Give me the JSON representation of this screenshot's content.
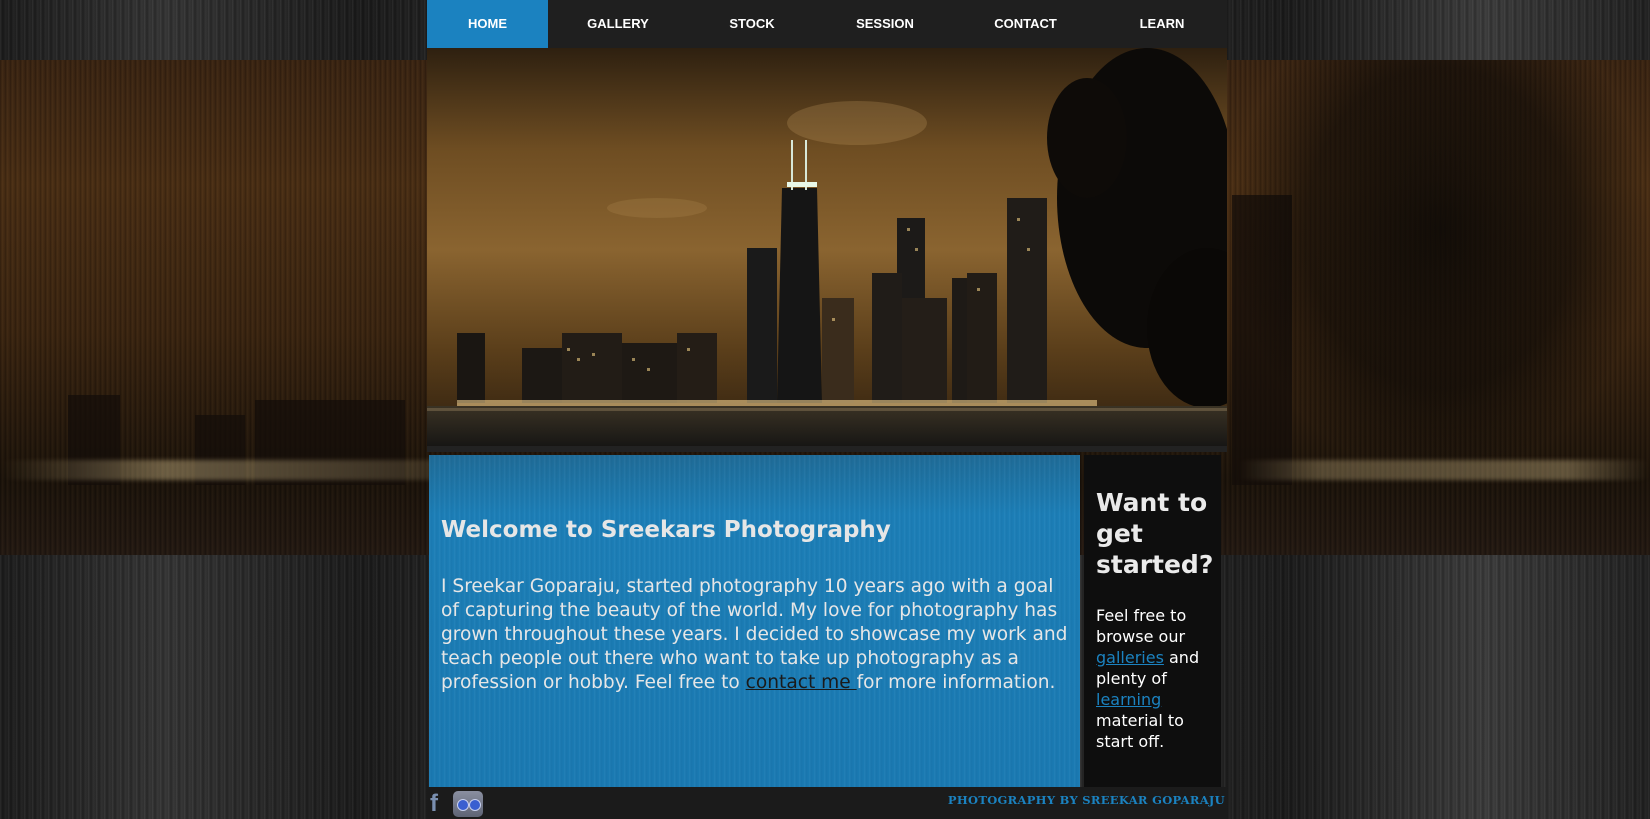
{
  "nav": {
    "items": [
      {
        "label": "HOME",
        "active": true
      },
      {
        "label": "GALLERY",
        "active": false
      },
      {
        "label": "STOCK",
        "active": false
      },
      {
        "label": "SESSION",
        "active": false
      },
      {
        "label": "CONTACT",
        "active": false
      },
      {
        "label": "LEARN",
        "active": false
      }
    ]
  },
  "hero": {
    "image": "night-city-skyline-photo"
  },
  "welcome": {
    "title": "Welcome to Sreekars Photography",
    "body_before_link": "I Sreekar Goparaju, started photography 10 years ago with a goal of capturing the beauty of the world. My love for photography has grown throughout these years. I decided to showcase my work and teach people out there who want to take up photography as a profession or hobby. Feel free to ",
    "link_text": "contact me ",
    "body_after_link": "for more information."
  },
  "sidebar": {
    "title": "Want to get started?",
    "text_1": "Feel free to browse our ",
    "link_galleries": "galleries",
    "text_2": " and plenty of ",
    "link_learning": "learning",
    "text_3": " material to start off."
  },
  "footer": {
    "facebook_icon": "f",
    "flickr_icon": "flickr-icon",
    "credit": "PHOTOGRAPHY BY SREEKAR GOPARAJU"
  },
  "colors": {
    "accent": "#1b82c0",
    "nav_bg": "#1f1f1f",
    "content_bg": "#1a7ab3",
    "sidebar_bg": "#0e0e0e"
  }
}
